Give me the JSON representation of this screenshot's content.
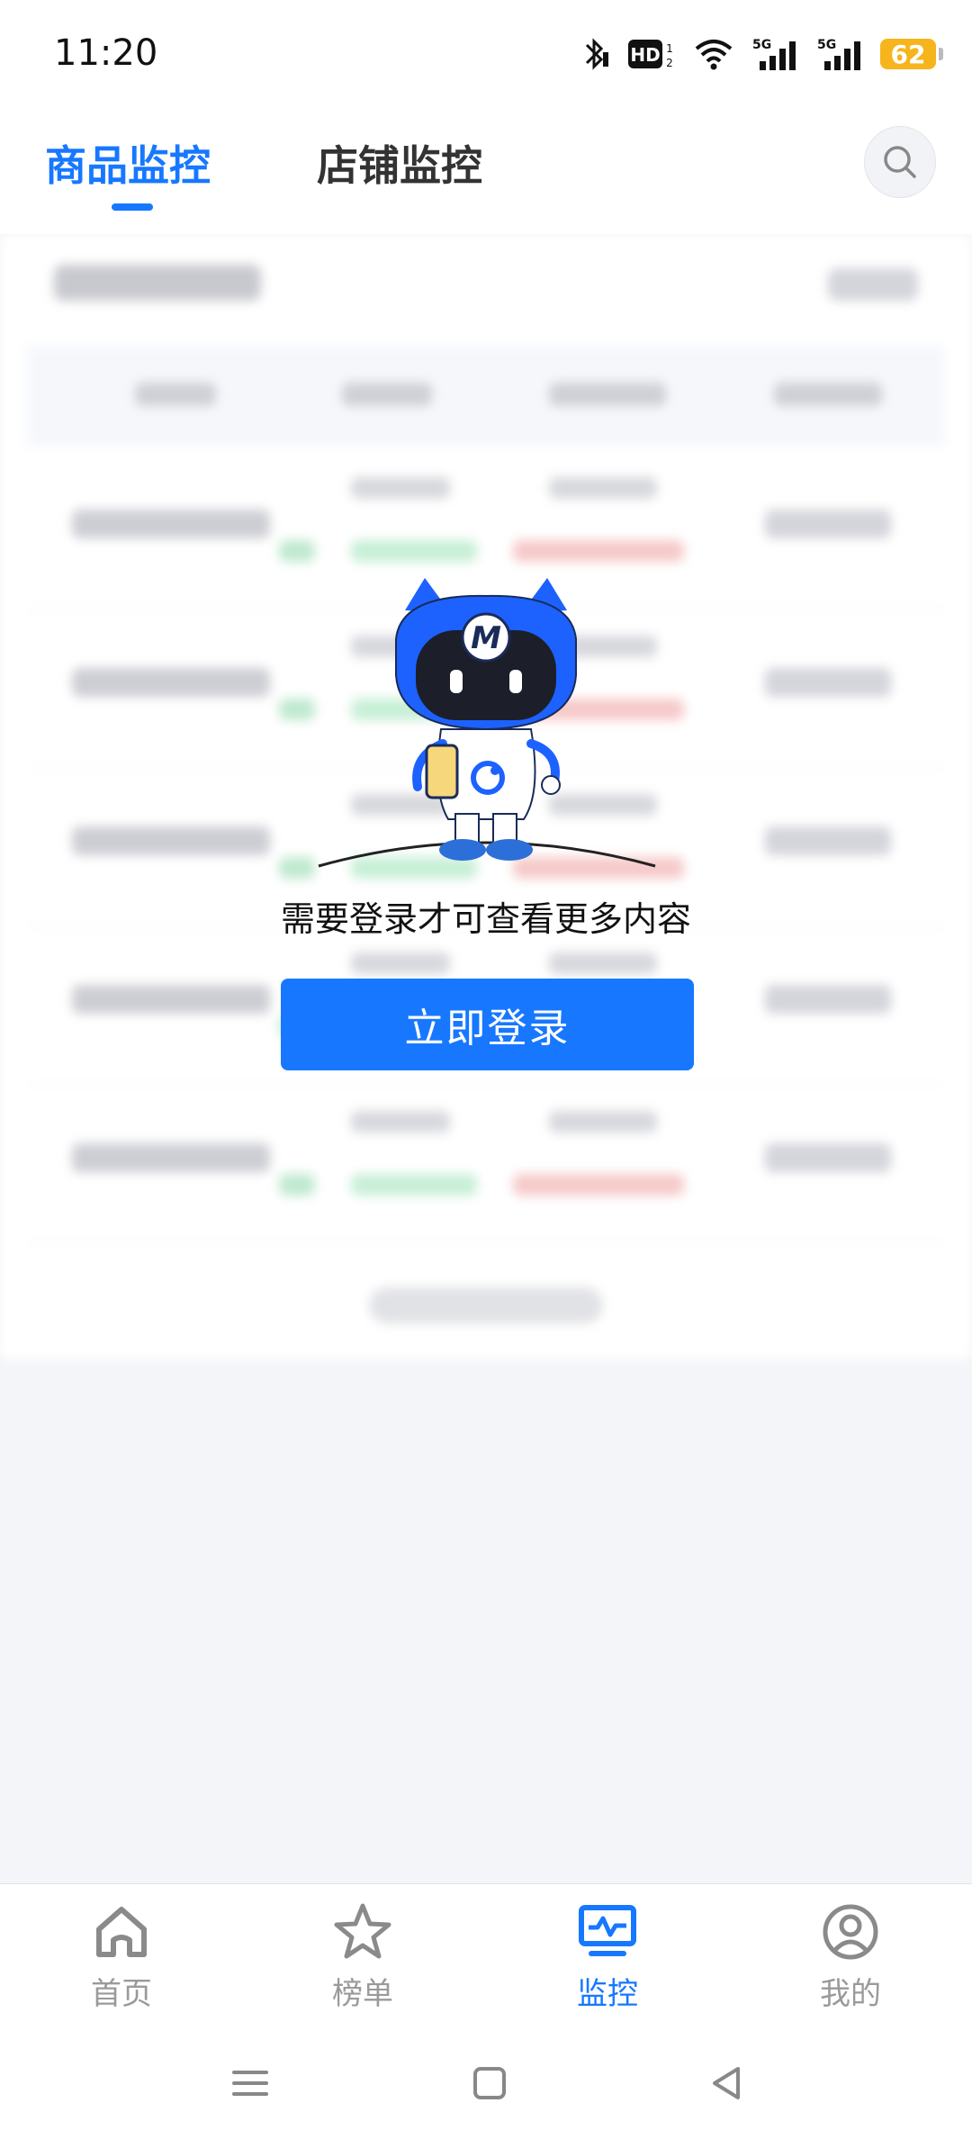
{
  "status_bar": {
    "time": "11:20",
    "battery": "62",
    "hd_label": "HD",
    "network_label": "5G",
    "icons": [
      "bluetooth-icon",
      "hd-icon",
      "wifi-icon",
      "signal-5g-icon",
      "signal-5g-icon",
      "battery-icon"
    ]
  },
  "header": {
    "tabs": [
      {
        "label": "商品监控",
        "active": true
      },
      {
        "label": "店铺监控",
        "active": false
      }
    ],
    "search_icon": "search-icon",
    "accent_color": "#1778ff"
  },
  "login_prompt": {
    "message": "需要登录才可查看更多内容",
    "button_label": "立即登录",
    "mascot_badge": "M"
  },
  "bottom_nav": {
    "items": [
      {
        "label": "首页",
        "icon": "home-icon",
        "active": false
      },
      {
        "label": "榜单",
        "icon": "star-icon",
        "active": false
      },
      {
        "label": "监控",
        "icon": "monitor-icon",
        "active": true
      },
      {
        "label": "我的",
        "icon": "user-icon",
        "active": false
      }
    ]
  },
  "system_nav": {
    "icons": [
      "menu-icon",
      "home-square-icon",
      "back-icon"
    ]
  }
}
